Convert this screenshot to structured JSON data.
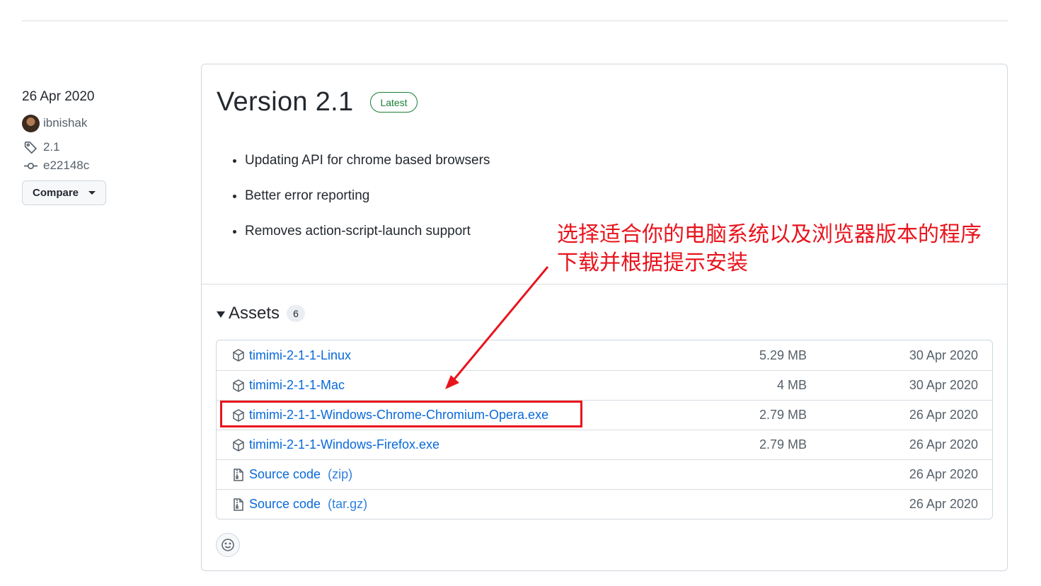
{
  "meta": {
    "date": "26 Apr 2020",
    "author": "ibnishak",
    "tag": "2.1",
    "commit": "e22148c",
    "compare_label": "Compare"
  },
  "release": {
    "title": "Version 2.1",
    "badge": "Latest",
    "notes": [
      "Updating API for chrome based browsers",
      "Better error reporting",
      "Removes action-script-launch support"
    ]
  },
  "assets": {
    "title": "Assets",
    "count": "6",
    "items": [
      {
        "name": "timimi-2-1-1-Linux",
        "ext": "",
        "size": "5.29 MB",
        "date": "30 Apr 2020",
        "icon": "package-icon"
      },
      {
        "name": "timimi-2-1-1-Mac",
        "ext": "",
        "size": "4 MB",
        "date": "30 Apr 2020",
        "icon": "package-icon"
      },
      {
        "name": "timimi-2-1-1-Windows-Chrome-Chromium-Opera.exe",
        "ext": "",
        "size": "2.79 MB",
        "date": "26 Apr 2020",
        "icon": "package-icon"
      },
      {
        "name": "timimi-2-1-1-Windows-Firefox.exe",
        "ext": "",
        "size": "2.79 MB",
        "date": "26 Apr 2020",
        "icon": "package-icon"
      },
      {
        "name": "Source code",
        "ext": "(zip)",
        "size": "",
        "date": "26 Apr 2020",
        "icon": "file-zip-icon"
      },
      {
        "name": "Source code",
        "ext": "(tar.gz)",
        "size": "",
        "date": "26 Apr 2020",
        "icon": "file-zip-icon"
      }
    ]
  },
  "annotation": {
    "line1": "选择适合你的电脑系统以及浏览器版本的程序",
    "line2": "下载并根据提示安装",
    "color": "#e8141d"
  },
  "colors": {
    "link": "#0969da",
    "latest": "#1a7f37",
    "muted": "#57606a"
  }
}
